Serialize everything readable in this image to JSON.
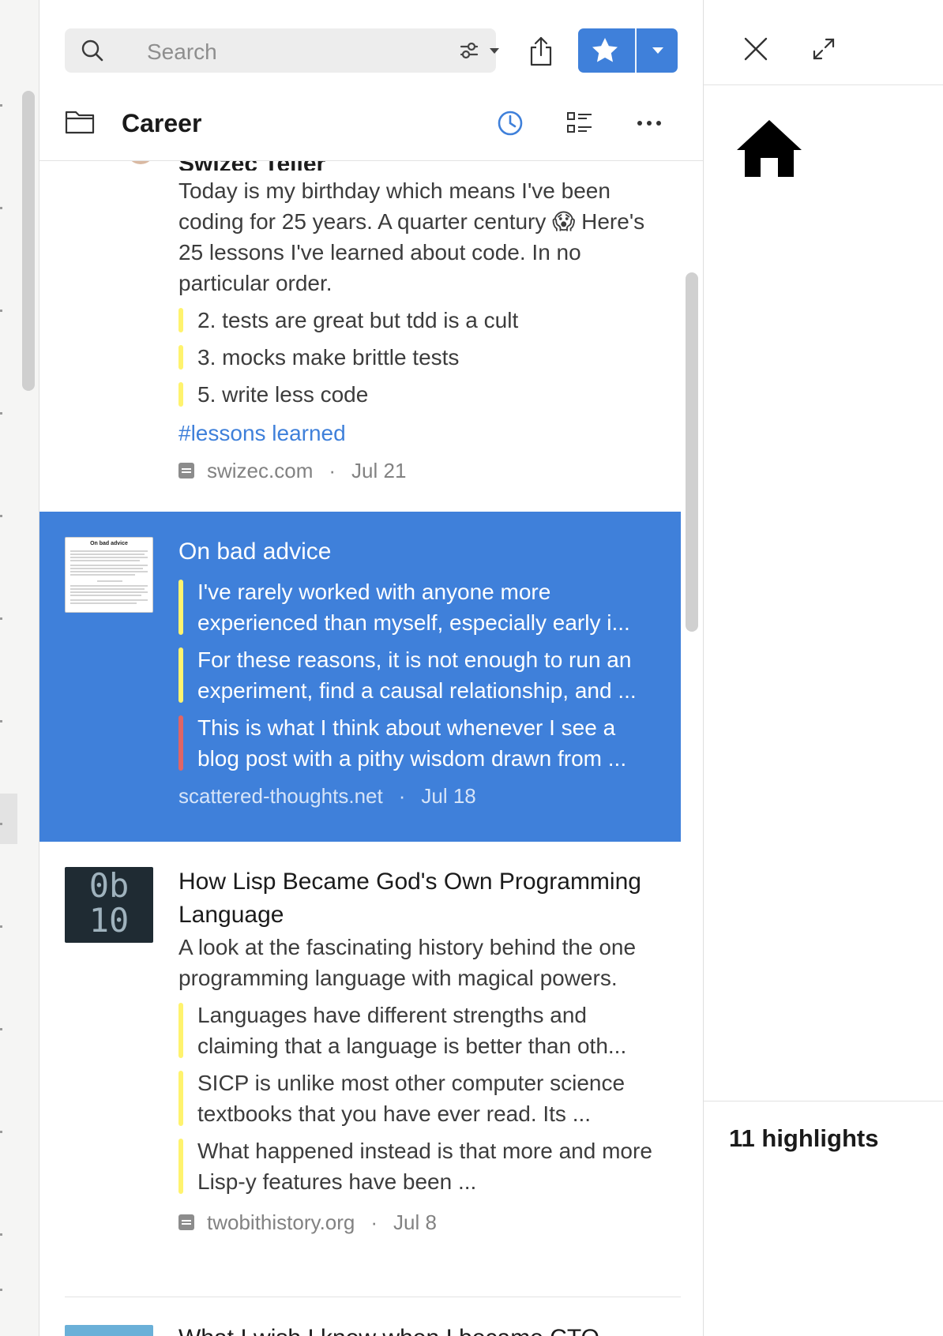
{
  "search": {
    "placeholder": "Search"
  },
  "header": {
    "title": "Career"
  },
  "colors": {
    "accent": "#3f80da",
    "highlight_yellow": "#fff36e",
    "highlight_red": "#e06565"
  },
  "feed": [
    {
      "title": "Swizec Teller",
      "description": "Today is my birthday which means I've been coding for 25 years. A quarter century 😱 Here's 25 lessons I've learned about code. In no particular order.",
      "highlights": [
        "2. tests are great but tdd is a cult",
        "3. mocks make brittle tests",
        "5. write less code"
      ],
      "tag": "#lessons learned",
      "source": "swizec.com",
      "date": "Jul 21"
    },
    {
      "title": "On bad advice",
      "highlights": [
        "I've rarely worked with anyone more experienced than myself, especially early i...",
        "For these reasons, it is not enough to run an experiment, find a causal relationship, and ...",
        "This is what I think about whenever I see a blog post with a pithy wisdom drawn from ..."
      ],
      "source": "scattered-thoughts.net",
      "date": "Jul 18",
      "thumb_title": "On bad advice"
    },
    {
      "title": "How Lisp Became God's Own Programming Language",
      "description": "A look at the fascinating history behind the one programming language with magical powers.",
      "highlights": [
        "Languages have different strengths and claiming that a language is better than oth...",
        "SICP is unlike most other computer science textbooks that you have ever read. Its ...",
        "What happened instead is that more and more Lisp-y features have been ..."
      ],
      "source": "twobithistory.org",
      "date": "Jul 8",
      "thumb_line1": "0b",
      "thumb_line2": "10"
    },
    {
      "title": "What I wish I knew when I became CTO"
    }
  ],
  "right_panel": {
    "highlights_count": "11 highlights"
  }
}
